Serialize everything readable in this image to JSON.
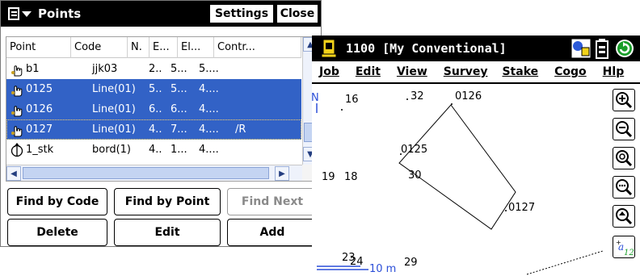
{
  "points_window": {
    "title": "Points",
    "settings_label": "Settings",
    "close_label": "Close",
    "columns": [
      "Point",
      "Code",
      "N.",
      "E...",
      "El...",
      "Contr..."
    ],
    "rows": [
      {
        "point": "b1",
        "code": "jjk03",
        "n": "2..",
        "e": "5...",
        "el": "5....",
        "control": "",
        "selected": false,
        "icon": "hand-point-icon"
      },
      {
        "point": "0125",
        "code": "Line(01)",
        "n": "5..",
        "e": "5...",
        "el": "4....",
        "control": "",
        "selected": true,
        "icon": "hand-point-icon"
      },
      {
        "point": "0126",
        "code": "Line(01)",
        "n": "6..",
        "e": "6...",
        "el": "4....",
        "control": "",
        "selected": true,
        "icon": "hand-point-icon"
      },
      {
        "point": "0127",
        "code": "Line(01)",
        "n": "4..",
        "e": "7...",
        "el": "4....",
        "control": "/R",
        "selected": true,
        "icon": "hand-point-icon"
      },
      {
        "point": "1_stk",
        "code": "bord(1)",
        "n": "4..",
        "e": "1...",
        "el": "4....",
        "control": "",
        "selected": false,
        "icon": "stake-point-icon"
      }
    ],
    "buttons": {
      "find_by_code": "Find by Code",
      "find_by_point": "Find by Point",
      "find_next": "Find Next",
      "delete": "Delete",
      "edit": "Edit",
      "add": "Add"
    }
  },
  "survey_window": {
    "title": "1100 [My Conventional]",
    "menu": [
      "Job",
      "Edit",
      "View",
      "Survey",
      "Stake",
      "Cogo",
      "Hlp"
    ],
    "map_labels": {
      "north": "N",
      "p16": "16",
      "p32": "32",
      "p0126": "0126",
      "p0125": "0125",
      "p19": "19",
      "p18": "18",
      "p30": "30",
      "p0127": "0127",
      "p23": "23",
      "p24": "24",
      "p29": "29",
      "scale": "10 m"
    },
    "tools": [
      "zoom-in-icon",
      "zoom-out-icon",
      "zoom-extents-icon",
      "zoom-window-icon",
      "pan-icon",
      "label-toggle-icon"
    ]
  }
}
